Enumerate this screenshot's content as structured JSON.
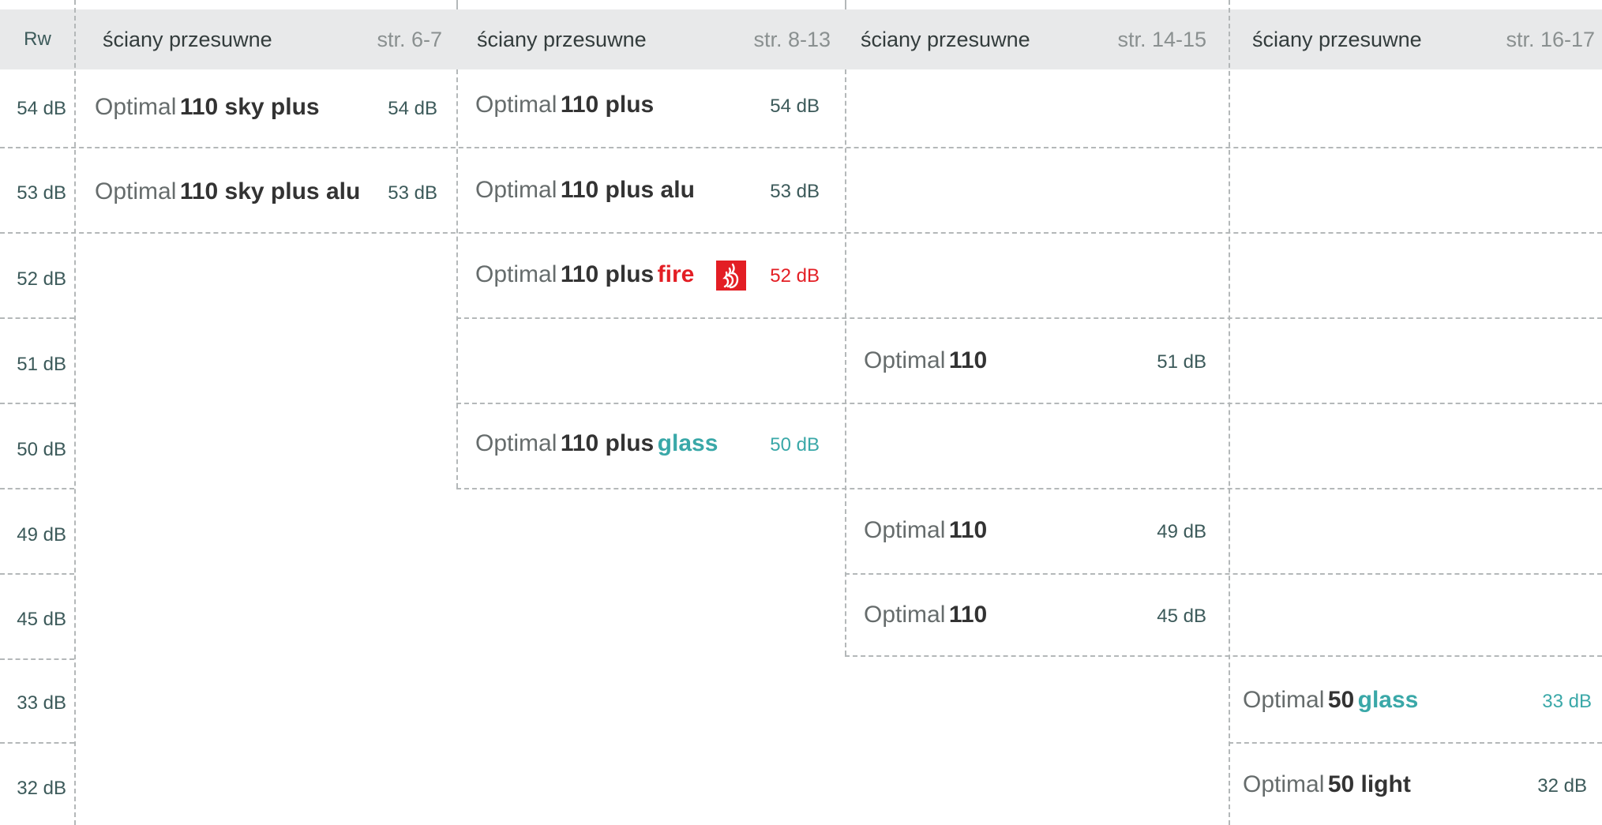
{
  "colors": {
    "fire": "#e31e24",
    "glass": "#3aa8a8",
    "label": "#3c5a5a",
    "header_bg": "#e8e9ea",
    "dash": "#b4b8b9"
  },
  "header": {
    "rw": "Rw",
    "columns": [
      {
        "title": "ściany przesuwne",
        "page": "str. 6-7"
      },
      {
        "title": "ściany przesuwne",
        "page": "str. 8-13"
      },
      {
        "title": "ściany przesuwne",
        "page": "str. 14-15"
      },
      {
        "title": "ściany przesuwne",
        "page": "str. 16-17"
      }
    ]
  },
  "rows": [
    "54 dB",
    "53 dB",
    "52 dB",
    "51 dB",
    "50 dB",
    "49 dB",
    "45 dB",
    "33 dB",
    "32 dB"
  ],
  "products": {
    "c1_54": {
      "prefix": "Optimal",
      "name": "110 sky plus",
      "value": "54 dB"
    },
    "c1_53": {
      "prefix": "Optimal",
      "name": "110 sky plus alu",
      "value": "53 dB"
    },
    "c2_54": {
      "prefix": "Optimal",
      "name": "110 plus",
      "value": "54 dB"
    },
    "c2_53": {
      "prefix": "Optimal",
      "name": "110 plus alu",
      "value": "53 dB"
    },
    "c2_52": {
      "prefix": "Optimal",
      "name": "110 plus",
      "variant": "fire",
      "value": "52 dB",
      "icon": "fire-icon"
    },
    "c2_50": {
      "prefix": "Optimal",
      "name": "110 plus",
      "variant": "glass",
      "value": "50 dB"
    },
    "c3_51": {
      "prefix": "Optimal",
      "name": "110",
      "value": "51 dB"
    },
    "c3_49": {
      "prefix": "Optimal",
      "name": "110",
      "value": "49 dB"
    },
    "c3_45": {
      "prefix": "Optimal",
      "name": "110",
      "value": "45 dB"
    },
    "c4_33": {
      "prefix": "Optimal",
      "name": "50",
      "variant": "glass",
      "value": "33 dB"
    },
    "c4_32": {
      "prefix": "Optimal",
      "name": "50 light",
      "value": "32 dB"
    }
  }
}
